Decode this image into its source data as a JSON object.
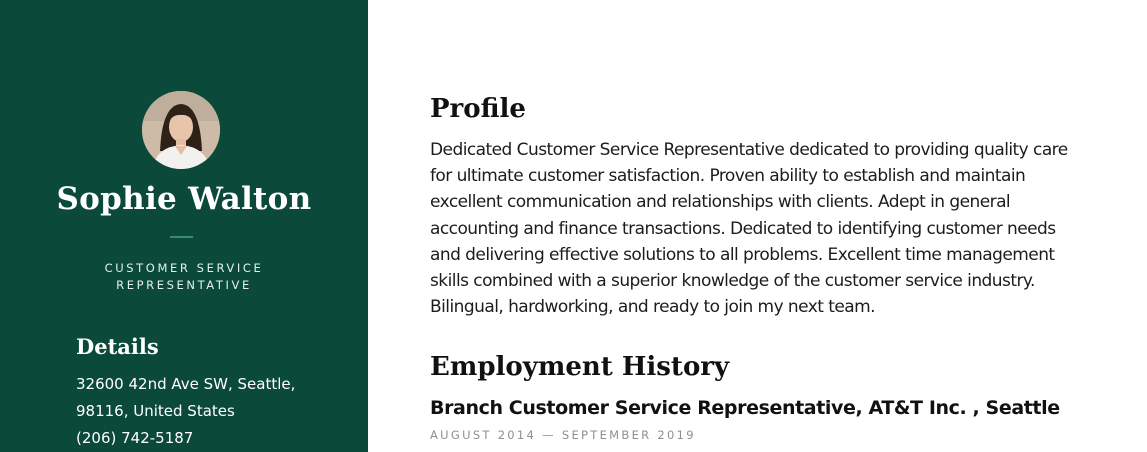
{
  "sidebar": {
    "name": "Sophie Walton",
    "job_title": "CUSTOMER SERVICE REPRESENTATIVE",
    "details_heading": "Details",
    "details": [
      "32600 42nd Ave SW, Seattle,",
      "98116, United States",
      "(206) 742-5187"
    ],
    "background_color": "#0b4a3a"
  },
  "main": {
    "profile": {
      "heading": "Profile",
      "text": "Dedicated Customer Service Representative dedicated to providing quality care for ultimate customer satisfaction. Proven ability to establish and maintain excellent communication and relationships with clients. Adept in general accounting and finance transactions. Dedicated to identifying customer needs and delivering effective solutions to all problems. Excellent time management skills combined with a superior knowledge of the customer service industry. Bilingual, hardworking, and ready to join my next team."
    },
    "employment": {
      "heading": "Employment History",
      "entries": [
        {
          "title": "Branch Customer Service Representative, AT&T Inc. , Seattle",
          "dates": "AUGUST 2014 — SEPTEMBER 2019"
        }
      ]
    }
  }
}
